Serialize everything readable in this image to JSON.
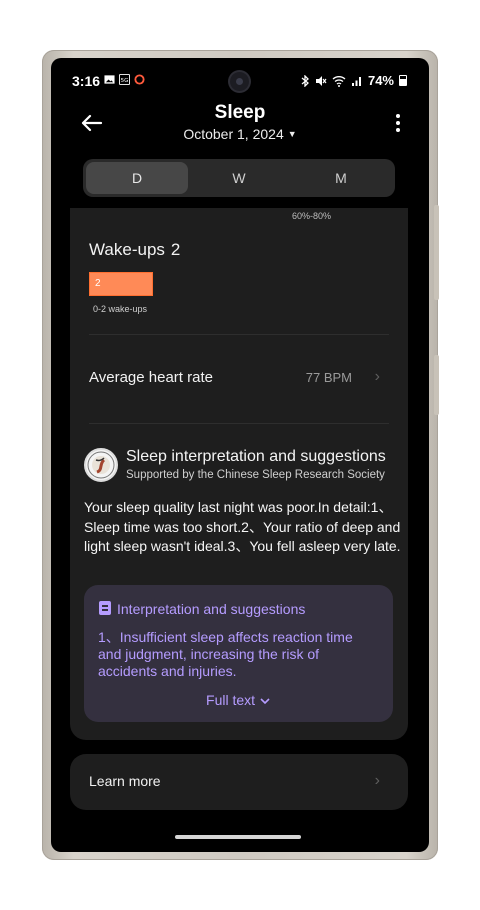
{
  "status_bar": {
    "time": "3:16",
    "battery": "74%",
    "icons": [
      "gallery-icon",
      "data-icon",
      "circle-icon",
      "bluetooth-icon",
      "mute-icon",
      "wifi-icon",
      "signal-icon",
      "battery-icon"
    ]
  },
  "header": {
    "title": "Sleep",
    "date": "October 1, 2024"
  },
  "tabs": [
    {
      "label": "D",
      "active": true
    },
    {
      "label": "W",
      "active": false
    },
    {
      "label": "M",
      "active": false
    }
  ],
  "card": {
    "range_top": "60%-80%",
    "wakeups": {
      "label": "Wake-ups",
      "value": "2",
      "bar_value": "2",
      "range_label": "0-2 wake-ups"
    },
    "heart_rate": {
      "label": "Average heart rate",
      "value": "77 BPM"
    },
    "interpretation": {
      "title": "Sleep interpretation and suggestions",
      "subtitle": "Supported by the Chinese Sleep Research Society",
      "summary": "Your sleep quality last night was poor.In detail:1、Sleep time was too short.2、Your ratio of deep and light sleep wasn't ideal.3、You fell asleep very late.",
      "box_title": "Interpretation and suggestions",
      "box_text": "1、Insufficient sleep affects reaction time and judgment, increasing the risk of accidents and injuries.",
      "full_text": "Full text"
    }
  },
  "learn_more": "Learn more",
  "colors": {
    "accent": "#b59cff",
    "wakeup_bar": "#ff8a57",
    "card_bg": "#1e1e1e"
  }
}
